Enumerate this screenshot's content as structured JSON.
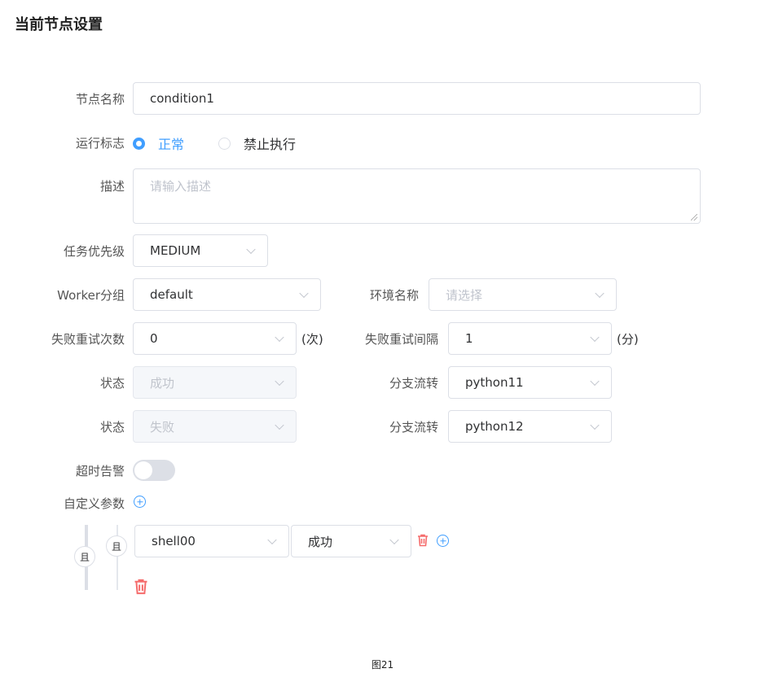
{
  "page_title": "当前节点设置",
  "form": {
    "node_name": {
      "label": "节点名称",
      "value": "condition1"
    },
    "run_flag": {
      "label": "运行标志",
      "options": [
        "正常",
        "禁止执行"
      ],
      "selected": "正常"
    },
    "description": {
      "label": "描述",
      "placeholder": "请输入描述"
    },
    "priority": {
      "label": "任务优先级",
      "value": "MEDIUM"
    },
    "worker_group": {
      "label": "Worker分组",
      "value": "default"
    },
    "env_name": {
      "label": "环境名称",
      "placeholder": "请选择"
    },
    "fail_retry_times": {
      "label": "失败重试次数",
      "value": "0",
      "unit": "(次)"
    },
    "fail_retry_interval": {
      "label": "失败重试间隔",
      "value": "1",
      "unit": "(分)"
    },
    "state_rows": [
      {
        "state_label": "状态",
        "state_value": "成功",
        "branch_label": "分支流转",
        "branch_value": "python11"
      },
      {
        "state_label": "状态",
        "state_value": "失败",
        "branch_label": "分支流转",
        "branch_value": "python12"
      }
    ],
    "timeout_alarm": {
      "label": "超时告警",
      "enabled": false
    },
    "custom_params": {
      "label": "自定义参数"
    },
    "condition": {
      "outer_relation": "且",
      "inner_relation": "且",
      "task_value": "shell00",
      "status_value": "成功"
    }
  },
  "caption": "图21",
  "colors": {
    "accent": "#409eff",
    "danger": "#f56c6c",
    "border": "#dcdfe6"
  }
}
